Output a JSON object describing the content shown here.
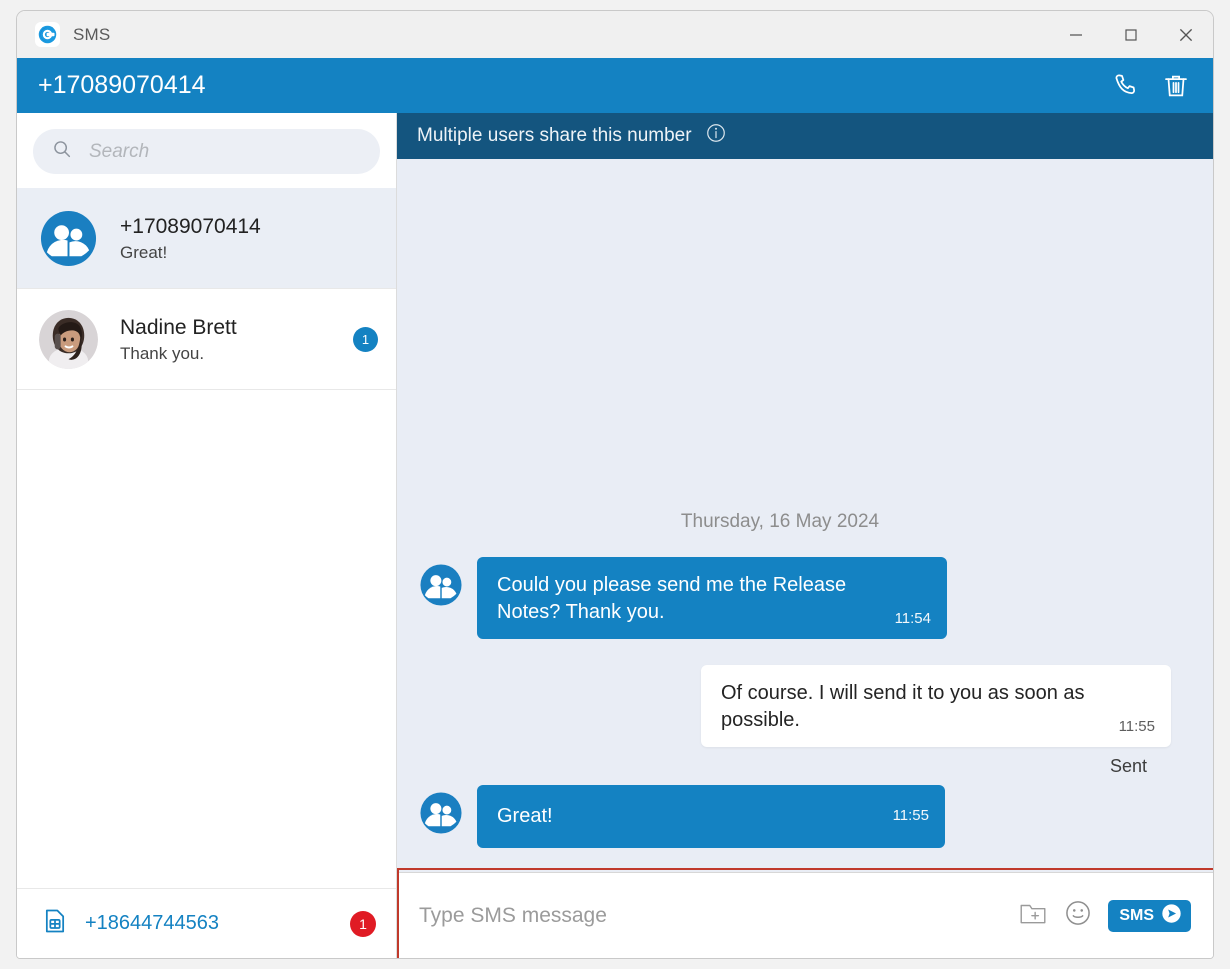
{
  "window": {
    "app_title": "SMS",
    "logo_icon": "g-logo-icon",
    "controls": {
      "minimize": "minimize-icon",
      "maximize": "maximize-icon",
      "close": "close-icon"
    }
  },
  "header": {
    "number": "+17089070414",
    "call_icon": "phone-icon",
    "delete_icon": "trash-icon"
  },
  "sidebar": {
    "search": {
      "placeholder": "Search",
      "value": "",
      "icon": "search-icon"
    },
    "conversations": [
      {
        "title": "+17089070414",
        "preview": "Great!",
        "avatar": "group-avatar-icon",
        "badge": "",
        "selected": true
      },
      {
        "title": "Nadine Brett",
        "preview": "Thank you.",
        "avatar": "person-photo-avatar",
        "badge": "1",
        "selected": false
      }
    ],
    "sim_row": {
      "icon": "sim-card-icon",
      "number": "+18644744563",
      "badge": "1"
    }
  },
  "chat": {
    "notice": {
      "text": "Multiple users share this number",
      "icon": "info-icon"
    },
    "date_separator": "Thursday, 16 May 2024",
    "messages": [
      {
        "direction": "in",
        "text": "Could you please send me the Release Notes? Thank you.",
        "time": "11:54",
        "avatar": "group-avatar-icon"
      },
      {
        "direction": "out",
        "text": "Of course. I will send it to you as soon as possible.",
        "time": "11:55",
        "status": "Sent"
      },
      {
        "direction": "in",
        "text": "Great!",
        "time": "11:55",
        "avatar": "group-avatar-icon"
      }
    ]
  },
  "composer": {
    "placeholder": "Type SMS message",
    "value": "",
    "attach_icon": "attach-folder-icon",
    "emoji_icon": "emoji-smiley-icon",
    "send_label": "SMS",
    "send_icon": "send-arrow-icon"
  },
  "colors": {
    "accent": "#1482c2",
    "notice_bar": "#14557f",
    "chat_background": "#e9edf5",
    "badge_red": "#e01b24",
    "highlight": "#c0392b"
  }
}
